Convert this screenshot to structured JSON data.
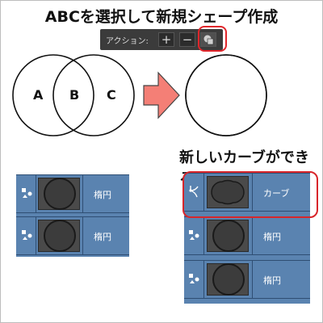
{
  "title": "ABCを選択して新規シェープ作成",
  "toolbar": {
    "label": "アクション:",
    "add_icon": "plus-icon",
    "subtract_icon": "minus-icon",
    "merge_icon": "merge-shapes-icon"
  },
  "venn": {
    "labels": [
      "A",
      "B",
      "C"
    ],
    "arrow_color": "#f47f76"
  },
  "subtitle": "新しいカーブができる",
  "layers_left": {
    "rows": [
      {
        "name": "楕円",
        "icon": "shape-tool-icon"
      },
      {
        "name": "楕円",
        "icon": "shape-tool-icon"
      }
    ]
  },
  "layers_right": {
    "rows": [
      {
        "name": "カーブ",
        "icon": "curve-tool-icon"
      },
      {
        "name": "楕円",
        "icon": "shape-tool-icon"
      },
      {
        "name": "楕円",
        "icon": "shape-tool-icon"
      }
    ]
  },
  "colors": {
    "layer_bg": "#5a83b0",
    "highlight": "#d8262b",
    "toolbar_bg": "#3b3b3b"
  }
}
